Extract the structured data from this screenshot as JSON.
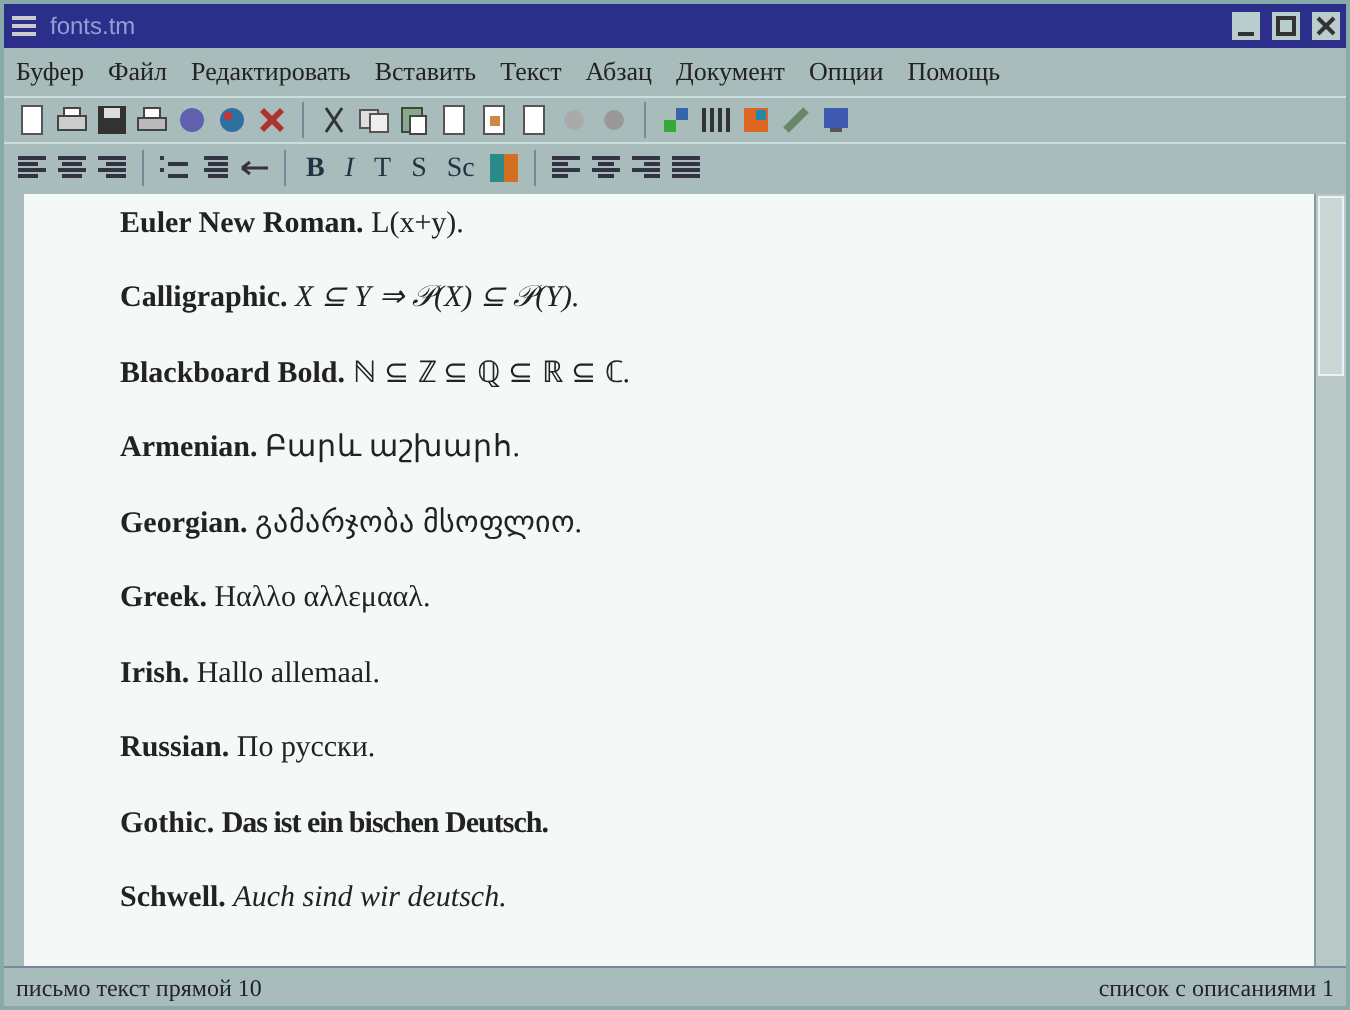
{
  "window": {
    "title": "fonts.tm"
  },
  "menu": [
    "Буфер",
    "Файл",
    "Редактировать",
    "Вставить",
    "Текст",
    "Абзац",
    "Документ",
    "Опции",
    "Помощь"
  ],
  "format_buttons": [
    {
      "label": "B",
      "kind": "bold"
    },
    {
      "label": "I",
      "kind": "italic"
    },
    {
      "label": "T",
      "kind": "plain"
    },
    {
      "label": "S",
      "kind": "plain"
    },
    {
      "label": "Sc",
      "kind": "plain"
    }
  ],
  "lines": [
    {
      "label": "Euler New Roman.",
      "sample": "L(x+y).",
      "kind": "regular"
    },
    {
      "label": "Calligraphic.",
      "sample": "X ⊆ Y ⇒ 𝒫(X) ⊆ 𝒫(Y).",
      "kind": "italic"
    },
    {
      "label": "Blackboard Bold.",
      "sample": "ℕ ⊆ ℤ ⊆ ℚ ⊆ ℝ ⊆ ℂ.",
      "kind": "regular"
    },
    {
      "label": "Armenian.",
      "sample": "Բարև աշխարհ.",
      "kind": "regular"
    },
    {
      "label": "Georgian.",
      "sample": "გამარჯობა მსოფლიო.",
      "kind": "regular"
    },
    {
      "label": "Greek.",
      "sample": "Ηαλλο αλλεμααλ.",
      "kind": "regular"
    },
    {
      "label": "Irish.",
      "sample": "Hallo allemaal.",
      "kind": "regular"
    },
    {
      "label": "Russian.",
      "sample": "По русски.",
      "kind": "regular"
    },
    {
      "label": "Gothic.",
      "sample": "Das ist ein bischen Deutsch.",
      "kind": "heavy"
    },
    {
      "label": "Schwell.",
      "sample": "Auch sind wir deutsch.",
      "kind": "italic"
    }
  ],
  "status_bar": {
    "left": "письмо текст прямой 10",
    "right": "список с описаниями 1"
  }
}
